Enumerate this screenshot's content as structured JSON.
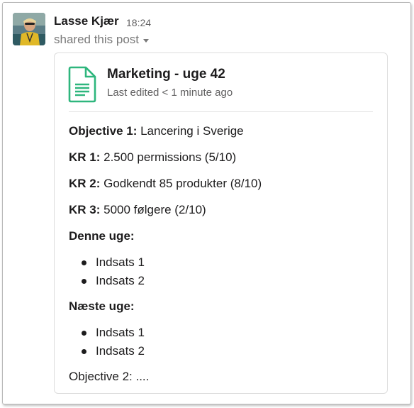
{
  "message": {
    "sender": "Lasse Kjær",
    "time": "18:24",
    "shared_label": "shared this post",
    "caret_icon": "chevron-down-icon"
  },
  "post": {
    "icon": "document-icon",
    "accent_color": "#2eb67d",
    "title": "Marketing - uge 42",
    "edited": "Last edited < 1 minute ago",
    "lines": [
      {
        "bold": "Objective 1:",
        "text": " Lancering i Sverige"
      },
      {
        "bold": "KR 1:",
        "text": " 2.500 permissions (5/10)"
      },
      {
        "bold": "KR 2:",
        "text": " Godkendt 85 produkter (8/10)"
      },
      {
        "bold": "KR 3:",
        "text": " 5000 følgere (2/10)"
      }
    ],
    "this_week": {
      "heading": "Denne uge:",
      "items": [
        "Indsats 1",
        "Indsats 2"
      ]
    },
    "next_week": {
      "heading": "Næste uge:",
      "items": [
        "Indsats 1",
        "Indsats 2"
      ]
    },
    "footer": "Objective 2: ...."
  }
}
